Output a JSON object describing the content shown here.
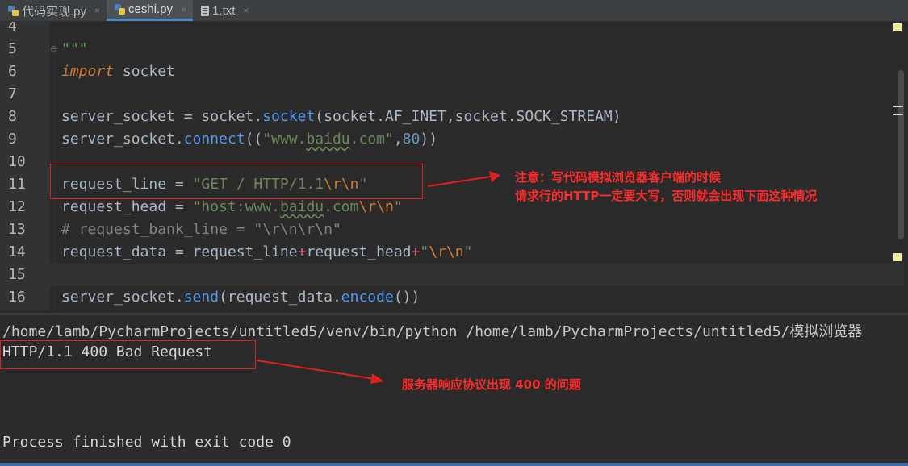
{
  "tabs": [
    {
      "name": "代码实现.py",
      "icon": "python-file-icon",
      "active": false
    },
    {
      "name": "ceshi.py",
      "icon": "python-file-icon",
      "active": true
    },
    {
      "name": "1.txt",
      "icon": "text-file-icon",
      "active": false
    }
  ],
  "close_glyph": "×",
  "editor": {
    "current_line": "15",
    "lines": [
      {
        "num": "4"
      },
      {
        "num": "5",
        "text": "\"\"\""
      },
      {
        "num": "6",
        "kw": "import",
        "rest": " socket"
      },
      {
        "num": "7"
      },
      {
        "num": "8",
        "a": "server_socket = socket.",
        "fn": "socket",
        "b": "(socket.AF_INET,socket.SOCK_STREAM)"
      },
      {
        "num": "9",
        "a": "server_socket.",
        "fn": "connect",
        "b": "((",
        "s1": "\"www.",
        "s2": "baidu",
        "s3": ".com\"",
        "c": ",",
        "n": "80",
        "d": "))"
      },
      {
        "num": "10"
      },
      {
        "num": "11",
        "a": "request_line = ",
        "s": "\"GET / HTTP/1.1",
        "e": "\\r\\n",
        "q": "\""
      },
      {
        "num": "12",
        "a": "request_head = ",
        "s1": "\"host:www.",
        "s2": "baidu",
        "s3": ".com",
        "e": "\\r\\n",
        "q": "\""
      },
      {
        "num": "13",
        "text": "# request_bank_line = \"\\r\\n\\r\\n\""
      },
      {
        "num": "14",
        "a": "request_data = request_line",
        "p1": "+",
        "b": "request_head",
        "p2": "+",
        "s": "\"",
        "e": "\\r\\n",
        "q": "\""
      },
      {
        "num": "15"
      },
      {
        "num": "16",
        "a": "server_socket.",
        "fn": "send",
        "b": "(request_data.",
        "fn2": "encode",
        "c": "())"
      }
    ]
  },
  "annotations": {
    "note1_line1": "注意：写代码模拟浏览器客户端的时候",
    "note1_line2": "请求行的HTTP一定要大写，否则就会出现下面这种情况",
    "note2": "服务器响应协议出现 400 的问题",
    "color": "#e02020"
  },
  "console": {
    "command": "/home/lamb/PycharmProjects/untitled5/venv/bin/python /home/lamb/PycharmProjects/untitled5/模拟浏览器",
    "response": "HTTP/1.1 400 Bad Request",
    "exit": "Process finished with exit code 0"
  }
}
